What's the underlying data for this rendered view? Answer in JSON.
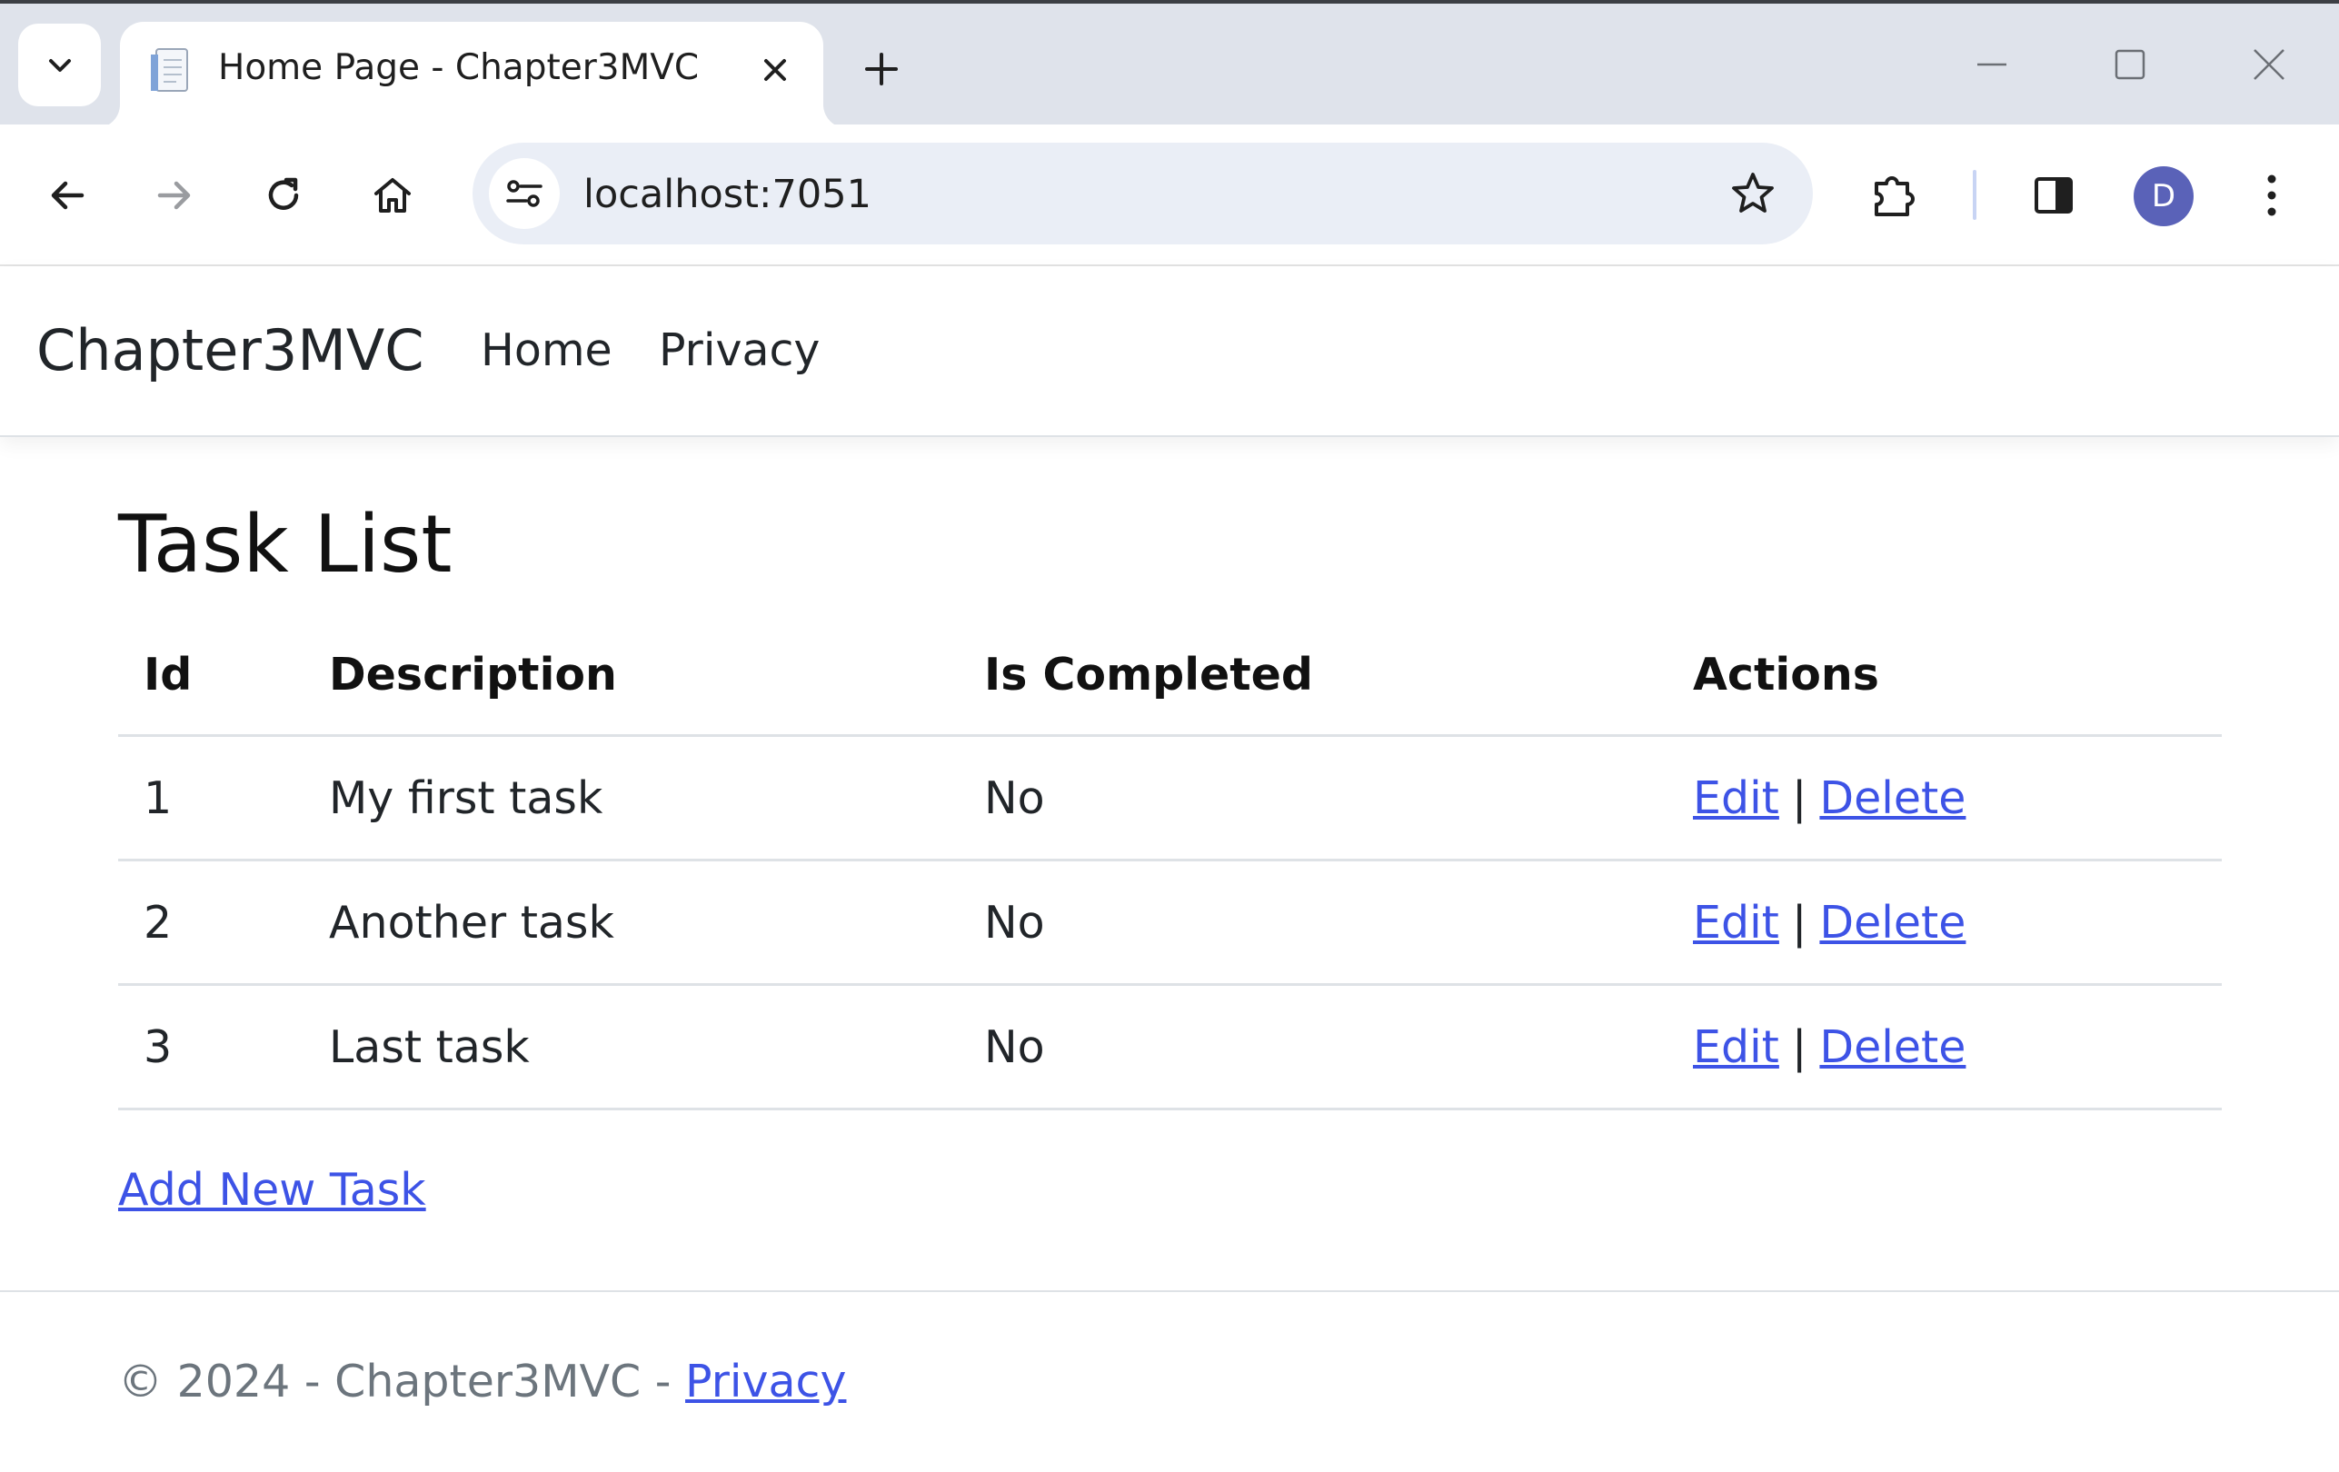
{
  "browser": {
    "tab_title": "Home Page - Chapter3MVC",
    "url": "localhost:7051",
    "profile_initial": "D",
    "icons": {
      "tab_search": "chevron-down-icon",
      "tab_close": "close-icon",
      "new_tab": "plus-icon",
      "minimize": "minimize-icon",
      "maximize": "maximize-icon",
      "close_window": "close-window-icon",
      "back": "arrow-left-icon",
      "forward": "arrow-right-icon",
      "reload": "reload-icon",
      "home": "home-icon",
      "site_info": "tune-icon",
      "bookmark": "star-icon",
      "extensions": "puzzle-icon",
      "side_panel": "side-panel-icon",
      "menu": "kebab-menu-icon"
    },
    "colors": {
      "tabstrip": "#dfe3eb",
      "omnibox": "#eaeef6",
      "avatar": "#5a62b8"
    }
  },
  "navbar": {
    "brand": "Chapter3MVC",
    "links": [
      "Home",
      "Privacy"
    ]
  },
  "main": {
    "title": "Task List",
    "table": {
      "headers": [
        "Id",
        "Description",
        "Is Completed",
        "Actions"
      ],
      "rows": [
        {
          "id": "1",
          "description": "My first task",
          "is_completed": "No",
          "edit": "Edit",
          "separator": "|",
          "delete": "Delete"
        },
        {
          "id": "2",
          "description": "Another task",
          "is_completed": "No",
          "edit": "Edit",
          "separator": "|",
          "delete": "Delete"
        },
        {
          "id": "3",
          "description": "Last task",
          "is_completed": "No",
          "edit": "Edit",
          "separator": "|",
          "delete": "Delete"
        }
      ]
    },
    "add_link": "Add New Task",
    "link_color": "#3d53e6"
  },
  "footer": {
    "text": "© 2024 - Chapter3MVC - ",
    "link": "Privacy"
  }
}
